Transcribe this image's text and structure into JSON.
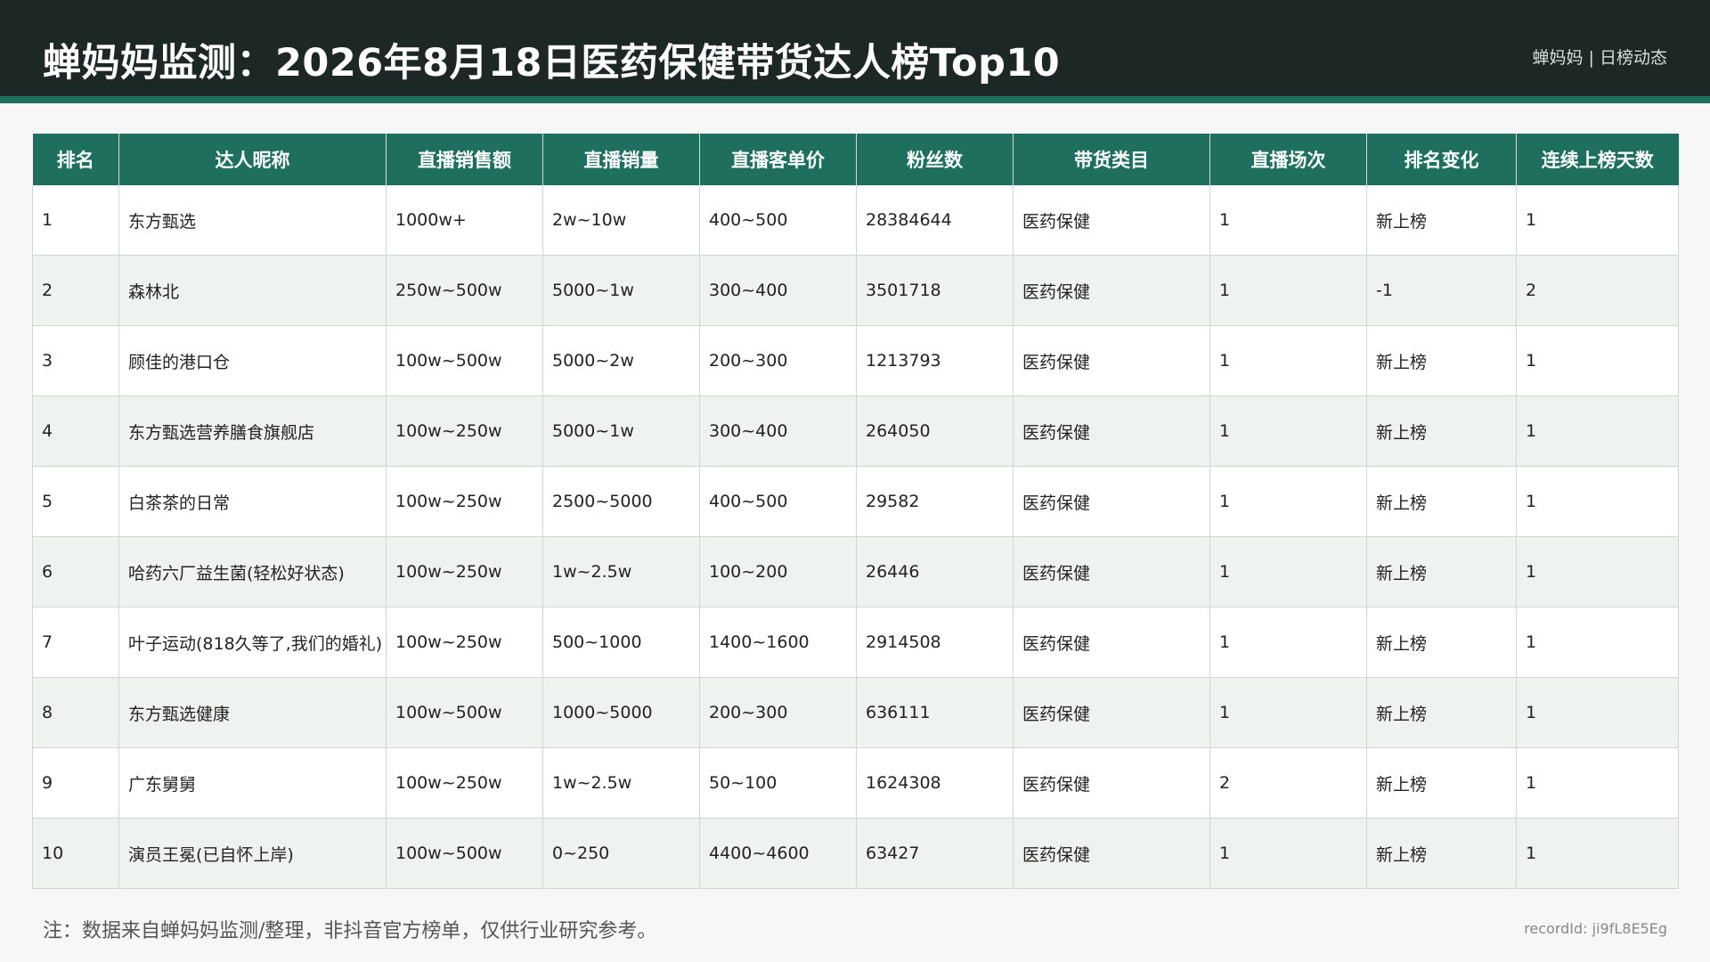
{
  "header": {
    "title": "蝉妈妈监测：2026年8月18日医药保健带货达人榜Top10",
    "brand": "蝉妈妈 | 日榜动态"
  },
  "table": {
    "columns": [
      "排名",
      "达人昵称",
      "直播销售额",
      "直播销量",
      "直播客单价",
      "粉丝数",
      "带货类目",
      "直播场次",
      "排名变化",
      "连续上榜天数"
    ],
    "rows": [
      [
        "1",
        "东方甄选",
        "1000w+",
        "2w~10w",
        "400~500",
        "28384644",
        "医药保健",
        "1",
        "新上榜",
        "1"
      ],
      [
        "2",
        "森林北",
        "250w~500w",
        "5000~1w",
        "300~400",
        "3501718",
        "医药保健",
        "1",
        "-1",
        "2"
      ],
      [
        "3",
        "顾佳的港口仓",
        "100w~500w",
        "5000~2w",
        "200~300",
        "1213793",
        "医药保健",
        "1",
        "新上榜",
        "1"
      ],
      [
        "4",
        "东方甄选营养膳食旗舰店",
        "100w~250w",
        "5000~1w",
        "300~400",
        "264050",
        "医药保健",
        "1",
        "新上榜",
        "1"
      ],
      [
        "5",
        "白茶茶的日常",
        "100w~250w",
        "2500~5000",
        "400~500",
        "29582",
        "医药保健",
        "1",
        "新上榜",
        "1"
      ],
      [
        "6",
        "哈药六厂益生菌(轻松好状态)",
        "100w~250w",
        "1w~2.5w",
        "100~200",
        "26446",
        "医药保健",
        "1",
        "新上榜",
        "1"
      ],
      [
        "7",
        "叶子运动(818久等了,我们的婚礼)",
        "100w~250w",
        "500~1000",
        "1400~1600",
        "2914508",
        "医药保健",
        "1",
        "新上榜",
        "1"
      ],
      [
        "8",
        "东方甄选健康",
        "100w~500w",
        "1000~5000",
        "200~300",
        "636111",
        "医药保健",
        "1",
        "新上榜",
        "1"
      ],
      [
        "9",
        "广东舅舅",
        "100w~250w",
        "1w~2.5w",
        "50~100",
        "1624308",
        "医药保健",
        "2",
        "新上榜",
        "1"
      ],
      [
        "10",
        "演员王冕(已自怀上岸)",
        "100w~500w",
        "0~250",
        "4400~4600",
        "63427",
        "医药保健",
        "1",
        "新上榜",
        "1"
      ]
    ]
  },
  "footer": {
    "note": "注：数据来自蝉妈妈监测/整理，非抖音官方榜单，仅供行业研究参考。",
    "record_id": "recordId: ji9fL8E5Eg"
  },
  "colors": {
    "header_bg": "#1d2725",
    "accent": "#1e6f5e",
    "row_alt": "#eef3f0"
  }
}
